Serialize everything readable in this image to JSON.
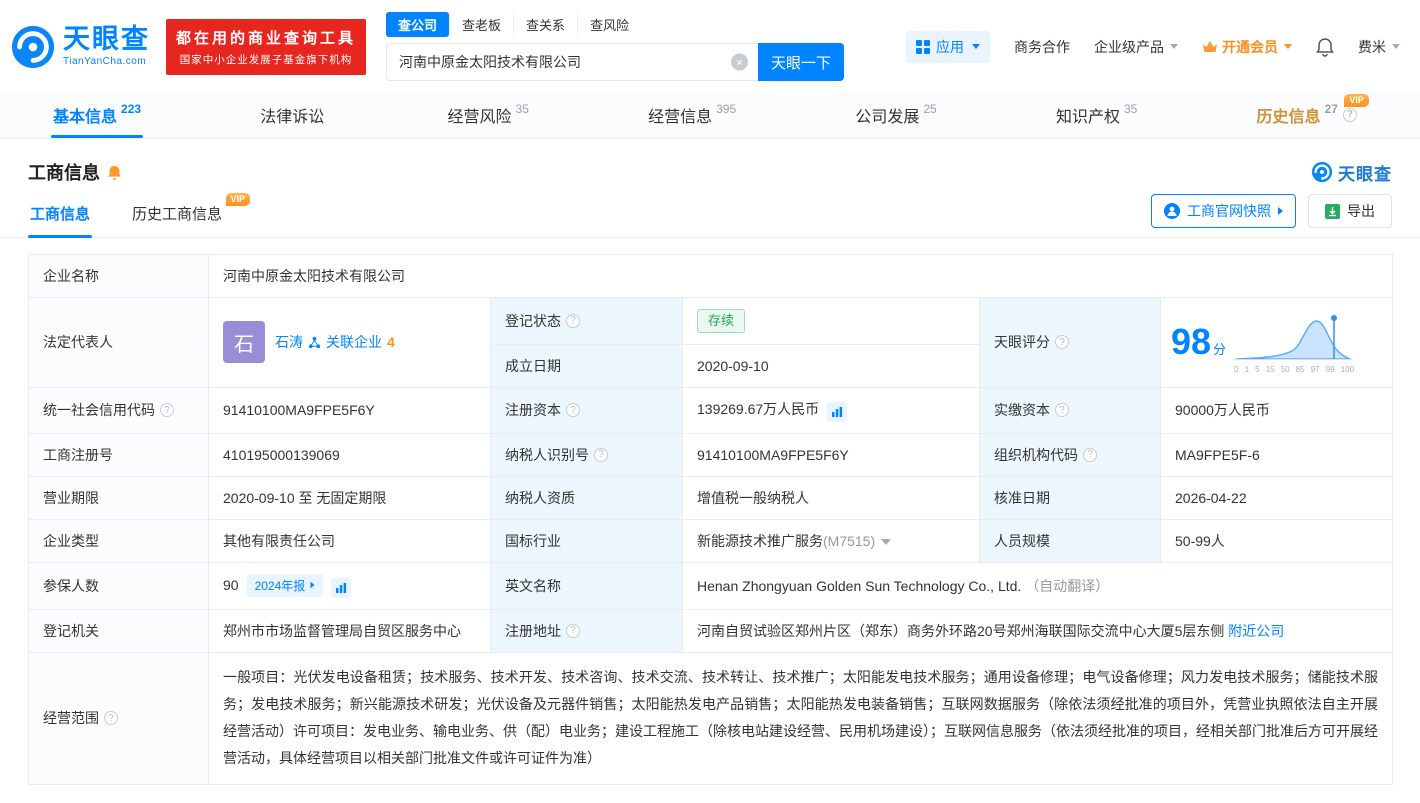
{
  "colors": {
    "primary": "#0084ff",
    "banner_red": "#e7261f",
    "vip_orange": "#ff8f1f",
    "status_green": "#23a757",
    "avatar_purple": "#988dd6"
  },
  "icons": {
    "clear": "×",
    "help": "?"
  },
  "header": {
    "logo": {
      "name": "天眼查",
      "domain": "TianYanCha.com"
    },
    "banner": {
      "line1": "都在用的商业查询工具",
      "line2": "国家中小企业发展子基金旗下机构"
    },
    "search": {
      "tabs": [
        "查公司",
        "查老板",
        "查关系",
        "查风险"
      ],
      "value": "河南中原金太阳技术有限公司",
      "button": "天眼一下"
    },
    "right": {
      "apps": "应用",
      "cooperation": "商务合作",
      "enterprise": "企业级产品",
      "vip": "开通会员",
      "user": "费米"
    }
  },
  "nav_tabs": [
    {
      "label": "基本信息",
      "count": "223"
    },
    {
      "label": "法律诉讼",
      "count": ""
    },
    {
      "label": "经营风险",
      "count": "35"
    },
    {
      "label": "经营信息",
      "count": "395"
    },
    {
      "label": "公司发展",
      "count": "25"
    },
    {
      "label": "知识产权",
      "count": "35"
    },
    {
      "label": "历史信息",
      "count": "27",
      "badge": "VIP"
    }
  ],
  "section": {
    "title": "工商信息",
    "brand": "天眼查",
    "subtabs": [
      {
        "label": "工商信息"
      },
      {
        "label": "历史工商信息",
        "badge": "VIP"
      }
    ],
    "snapshot_button": "工商官网快照",
    "export_button": "导出"
  },
  "fields": {
    "company_name_label": "企业名称",
    "company_name": "河南中原金太阳技术有限公司",
    "legal_rep_label": "法定代表人",
    "legal_rep_avatar": "石",
    "legal_rep_name": "石涛",
    "related_companies_label": "关联企业",
    "related_companies_count": "4",
    "reg_status_label": "登记状态",
    "reg_status_value": "存续",
    "est_date_label": "成立日期",
    "est_date_value": "2020-09-10",
    "score_label": "天眼评分",
    "score_value": "98",
    "score_unit": "分",
    "credit_code_label": "统一社会信用代码",
    "credit_code_value": "91410100MA9FPE5F6Y",
    "reg_capital_label": "注册资本",
    "reg_capital_value": "139269.67万人民币",
    "paid_capital_label": "实缴资本",
    "paid_capital_value": "90000万人民币",
    "reg_number_label": "工商注册号",
    "reg_number_value": "410195000139069",
    "taxpayer_id_label": "纳税人识别号",
    "taxpayer_id_value": "91410100MA9FPE5F6Y",
    "org_code_label": "组织机构代码",
    "org_code_value": "MA9FPE5F-6",
    "business_term_label": "营业期限",
    "business_term_value": "2020-09-10 至 无固定期限",
    "taxpayer_quality_label": "纳税人资质",
    "taxpayer_quality_value": "增值税一般纳税人",
    "approval_date_label": "核准日期",
    "approval_date_value": "2026-04-22",
    "company_type_label": "企业类型",
    "company_type_value": "其他有限责任公司",
    "industry_label": "国标行业",
    "industry_value": "新能源技术推广服务",
    "industry_code": "(M7515)",
    "staff_size_label": "人员规模",
    "staff_size_value": "50-99人",
    "insured_label": "参保人数",
    "insured_value": "90",
    "insured_badge": "2024年报",
    "english_name_label": "英文名称",
    "english_name_value": "Henan Zhongyuan Golden Sun Technology Co., Ltd.",
    "english_name_note": "（自动翻译）",
    "registry_label": "登记机关",
    "registry_value": "郑州市市场监督管理局自贸区服务中心",
    "address_label": "注册地址",
    "address_value": "河南自贸试验区郑州片区（郑东）商务外环路20号郑州海联国际交流中心大厦5层东侧",
    "address_link": "附近公司",
    "scope_label": "经营范围",
    "scope_value": "一般项目：光伏发电设备租赁；技术服务、技术开发、技术咨询、技术交流、技术转让、技术推广；太阳能发电技术服务；通用设备修理；电气设备修理；风力发电技术服务；储能技术服务；发电技术服务；新兴能源技术研发；光伏设备及元器件销售；太阳能热发电产品销售；太阳能热发电装备销售；互联网数据服务（除依法须经批准的项目外，凭营业执照依法自主开展经营活动）许可项目：发电业务、输电业务、供（配）电业务；建设工程施工（除核电站建设经营、民用机场建设）；互联网信息服务（依法须经批准的项目，经相关部门批准后方可开展经营活动，具体经营项目以相关部门批准文件或许可证件为准）"
  },
  "score_chart": {
    "axis": [
      "0",
      "1",
      "5",
      "15",
      "50",
      "85",
      "97",
      "99",
      "100"
    ]
  }
}
